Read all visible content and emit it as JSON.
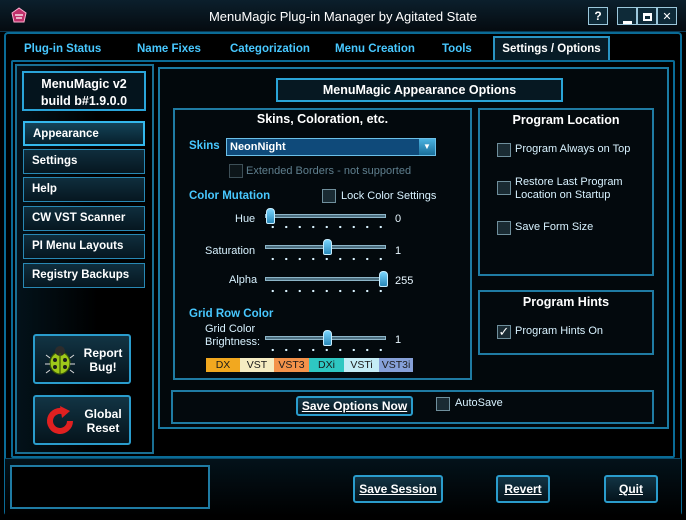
{
  "window": {
    "title": "MenuMagic Plug-in Manager by Agitated State",
    "help_label": "?",
    "minimize_label": "▬",
    "maximize_label": "□",
    "close_label": "✕"
  },
  "tabs": [
    {
      "label": "Plug-in Status"
    },
    {
      "label": "Name Fixes"
    },
    {
      "label": "Categorization"
    },
    {
      "label": "Menu Creation"
    },
    {
      "label": "Tools"
    },
    {
      "label": "Settings / Options",
      "selected": true
    }
  ],
  "sidebar": {
    "version_line1": "MenuMagic v2",
    "version_line2": "build b#1.9.0.0",
    "items": [
      {
        "label": "Appearance",
        "selected": true
      },
      {
        "label": "Settings"
      },
      {
        "label": "Help"
      },
      {
        "label": "CW VST Scanner"
      },
      {
        "label": "PI Menu Layouts"
      },
      {
        "label": "Registry Backups"
      }
    ],
    "report_bug_line1": "Report",
    "report_bug_line2": "Bug!",
    "global_reset_line1": "Global",
    "global_reset_line2": "Reset"
  },
  "main": {
    "title": "MenuMagic Appearance Options",
    "skins_group": {
      "title": "Skins, Coloration, etc.",
      "skins_label": "Skins",
      "skin_value": "NeonNight",
      "extended_borders_label": "Extended Borders - not supported",
      "color_mutation_label": "Color Mutation",
      "lock_color_label": "Lock Color Settings",
      "hue_label": "Hue",
      "hue_value": "0",
      "hue_fraction": 0.0,
      "saturation_label": "Saturation",
      "saturation_value": "1",
      "saturation_fraction": 0.5,
      "alpha_label": "Alpha",
      "alpha_value": "255",
      "alpha_fraction": 1.0,
      "grid_row_label": "Grid Row Color",
      "grid_brightness_line1": "Grid Color",
      "grid_brightness_line2": "Brightness:",
      "grid_brightness_value": "1",
      "grid_brightness_fraction": 0.5,
      "legend": [
        {
          "label": "DX",
          "color": "#f2a81f"
        },
        {
          "label": "VST",
          "color": "#f5ecc2"
        },
        {
          "label": "VST3",
          "color": "#f4924a"
        },
        {
          "label": "DXi",
          "color": "#2ec7c2"
        },
        {
          "label": "VSTi",
          "color": "#c4ecf6"
        },
        {
          "label": "VST3i",
          "color": "#86a0d8"
        }
      ]
    },
    "location_group": {
      "title": "Program Location",
      "always_on_top": "Program Always on Top",
      "restore_line1": "Restore Last Program",
      "restore_line2": "Location on Startup",
      "save_form_size": "Save Form Size"
    },
    "hints_group": {
      "title": "Program Hints",
      "hints_on": "Program Hints On",
      "hints_checked": true
    },
    "save_options_label": "Save Options Now",
    "autosave_label": "AutoSave"
  },
  "footer": {
    "save_session": "Save Session",
    "revert": "Revert",
    "quit": "Quit"
  },
  "colors": {
    "accent": "#48c8ff",
    "frame": "#0a6b96",
    "background": "#000000"
  }
}
